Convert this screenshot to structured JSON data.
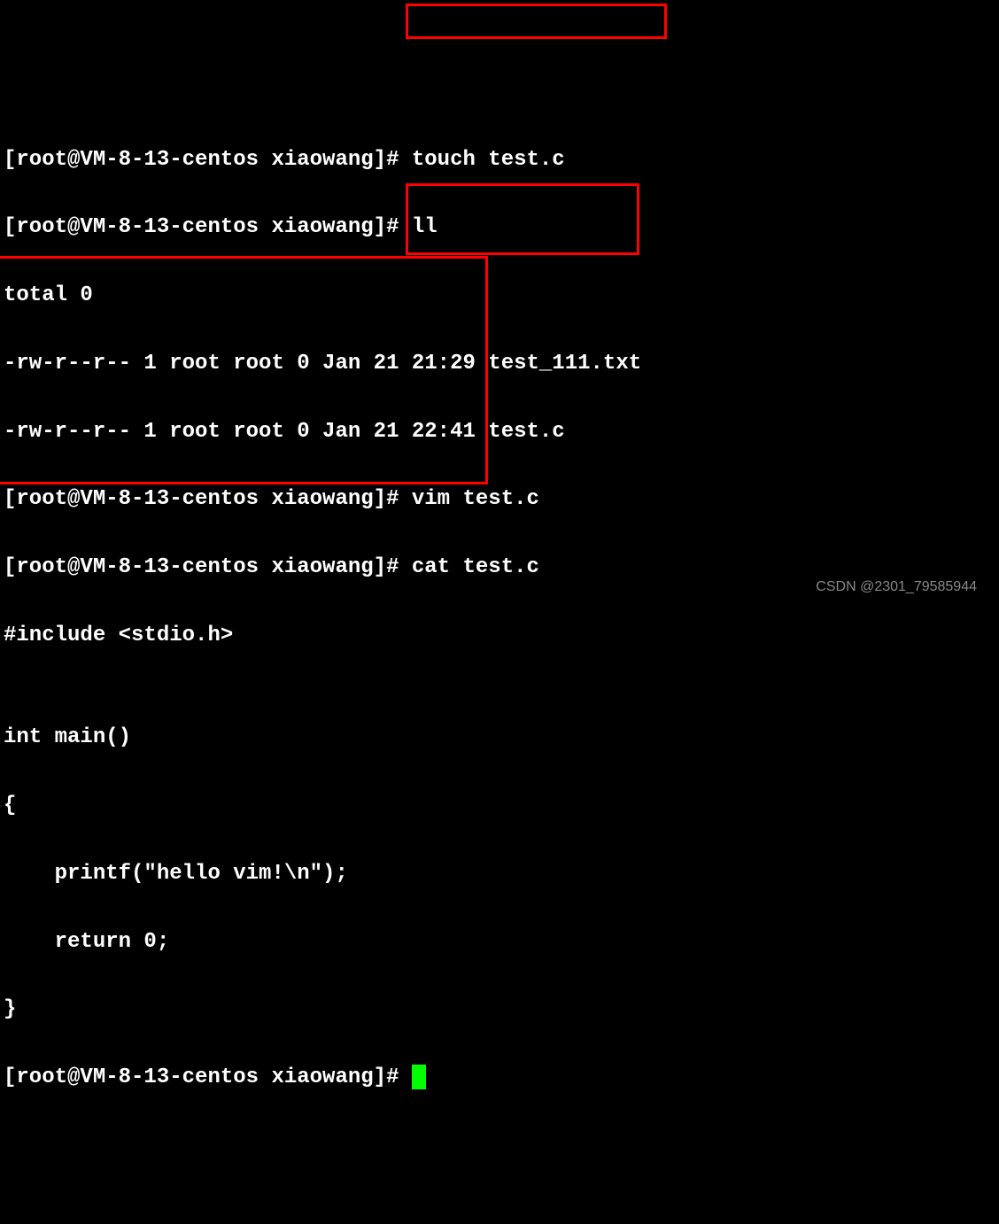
{
  "terminal": {
    "prompt": "[root@VM-8-13-centos xiaowang]# ",
    "commands": {
      "touch": "touch test.c",
      "ll": "ll",
      "vim": "vim test.c",
      "cat": "cat test.c"
    },
    "ll_output": {
      "total": "total 0",
      "file1": "-rw-r--r-- 1 root root 0 Jan 21 21:29 test_111.txt",
      "file2": "-rw-r--r-- 1 root root 0 Jan 21 22:41 test.c"
    },
    "cat_output": {
      "line1": "#include <stdio.h>",
      "line2": "",
      "line3": "int main()",
      "line4": "{",
      "line5": "    printf(\"hello vim!\\n\");",
      "line6": "    return 0;",
      "line7": "}"
    }
  },
  "watermark": "CSDN @2301_79585944"
}
